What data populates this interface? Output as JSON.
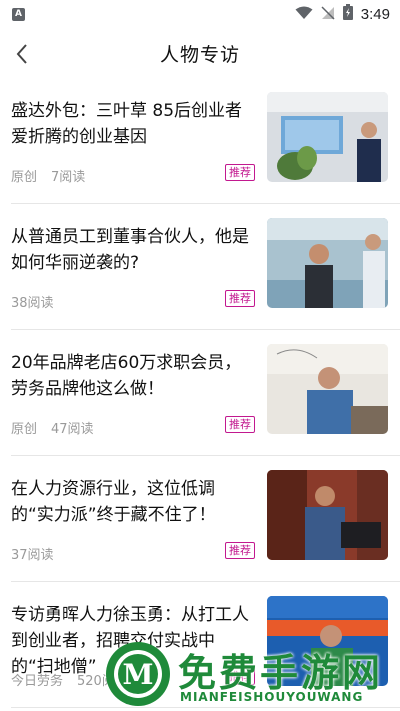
{
  "status_bar": {
    "app_badge": "A",
    "time": "3:49"
  },
  "header": {
    "title": "人物专访"
  },
  "articles": [
    {
      "title": "盛达外包：三叶草 85后创业者爱折腾的创业基因",
      "source": "原创",
      "reads": "7阅读",
      "tag": "推荐"
    },
    {
      "title": "从普通员工到董事合伙人，他是如何华丽逆袭的?",
      "source": "",
      "reads": "38阅读",
      "tag": "推荐"
    },
    {
      "title": "20年品牌老店60万求职会员，劳务品牌他这么做！",
      "source": "原创",
      "reads": "47阅读",
      "tag": "推荐"
    },
    {
      "title": "在人力资源行业，这位低调的“实力派”终于藏不住了！",
      "source": "",
      "reads": "37阅读",
      "tag": "推荐"
    },
    {
      "title": "专访勇晖人力徐玉勇：从打工人到创业者，招聘交付实战中的“扫地僧”",
      "source": "今日劳务",
      "reads": "520阅读",
      "tag": "推荐"
    }
  ],
  "watermark": {
    "logo_letter": "M",
    "cn": "免费手游网",
    "en": "MIANFEISHOUYOUWANG"
  },
  "colors": {
    "tag": "#c2188f",
    "meta": "#9a9a9a",
    "watermark": "#1f8a3a"
  }
}
